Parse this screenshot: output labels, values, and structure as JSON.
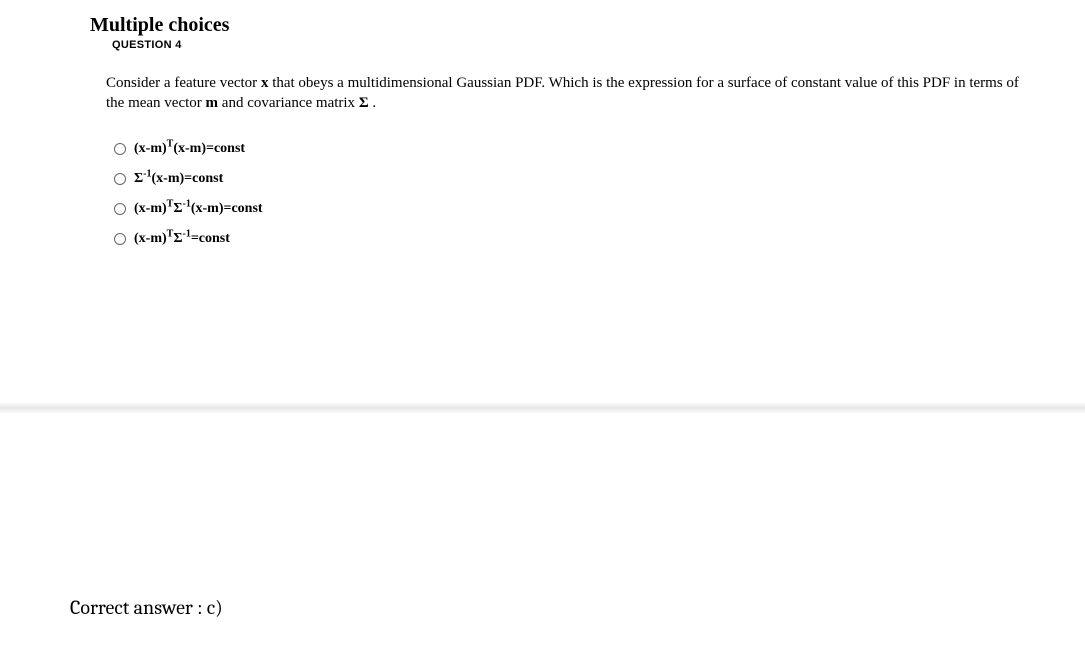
{
  "heading": "Multiple choices",
  "question_label": "QUESTION 4",
  "prompt_parts": {
    "t1": "Consider a feature vector ",
    "b1": "x",
    "t2": " that obeys a multidimensional Gaussian PDF. Which is the expression for a surface of constant value of this PDF in terms of the mean vector ",
    "b2": "m",
    "t3": " and covariance matrix ",
    "b3": "Σ",
    "t4": " ."
  },
  "options": [
    {
      "segments": [
        {
          "t": "(x-m)"
        },
        {
          "t": "T",
          "sup": true
        },
        {
          "t": "(x-m)=const"
        }
      ]
    },
    {
      "segments": [
        {
          "t": "Σ"
        },
        {
          "t": "-1",
          "sup": true
        },
        {
          "t": "(x-m)=const"
        }
      ]
    },
    {
      "segments": [
        {
          "t": "(x-m)"
        },
        {
          "t": "T",
          "sup": true
        },
        {
          "t": "Σ"
        },
        {
          "t": "-1",
          "sup": true
        },
        {
          "t": "(x-m)=const"
        }
      ]
    },
    {
      "segments": [
        {
          "t": "(x-m)"
        },
        {
          "t": "T",
          "sup": true
        },
        {
          "t": "Σ"
        },
        {
          "t": "-1",
          "sup": true
        },
        {
          "t": "=const"
        }
      ]
    }
  ],
  "answer": "Correct answer : c)"
}
